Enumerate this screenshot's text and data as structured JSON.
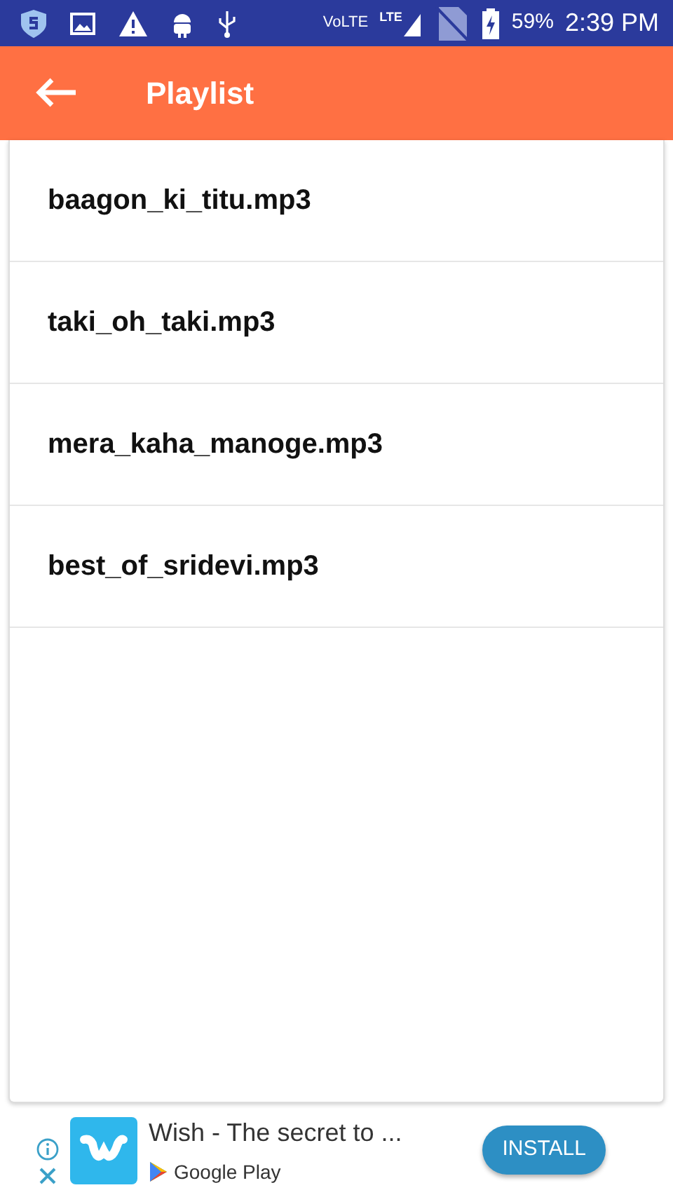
{
  "status_bar": {
    "volte": "VoLTE",
    "network": "LTE",
    "battery": "59%",
    "time": "2:39 PM"
  },
  "app_bar": {
    "title": "Playlist"
  },
  "playlist": [
    {
      "title": "baagon_ki_titu.mp3"
    },
    {
      "title": "taki_oh_taki.mp3"
    },
    {
      "title": "mera_kaha_manoge.mp3"
    },
    {
      "title": "best_of_sridevi.mp3"
    }
  ],
  "ad": {
    "title": "Wish - The secret to ...",
    "store": "Google Play",
    "button": "INSTALL"
  }
}
